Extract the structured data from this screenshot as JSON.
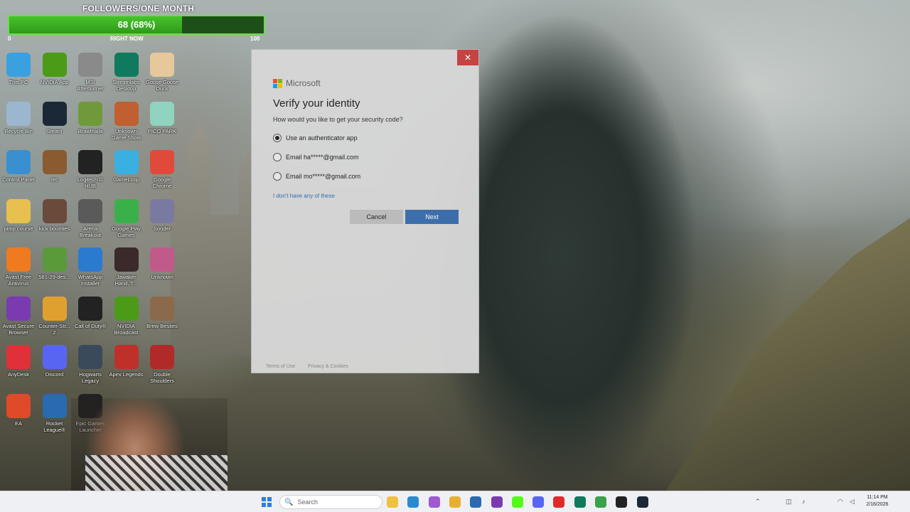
{
  "followers": {
    "title": "FOLLOWERS/ONE MONTH",
    "value_text": "68 (68%)",
    "progress": 68,
    "min_label": "0",
    "now_label": "RIGHT NOW",
    "max_label": "100"
  },
  "desktop_icons": [
    {
      "label": "This PC",
      "icon": "this-pc-icon",
      "color": "#3aa0e0"
    },
    {
      "label": "NVIDIA App",
      "icon": "nvidia-icon",
      "color": "#4b9b18"
    },
    {
      "label": "MSI Afterburner",
      "icon": "msi-icon",
      "color": "#8a8a8a"
    },
    {
      "label": "Streamlabs Desktop",
      "icon": "streamlabs-icon",
      "color": "#0f7a5d"
    },
    {
      "label": "Goose Goose Duck",
      "icon": "goose-icon",
      "color": "#e6c89a"
    },
    {
      "label": "Recycle Bin",
      "icon": "recycle-bin-icon",
      "color": "#9bb7d0"
    },
    {
      "label": "Steam",
      "icon": "steam-icon",
      "color": "#1b2838"
    },
    {
      "label": "Brawlhalla",
      "icon": "brawlhalla-icon",
      "color": "#6f9a3a"
    },
    {
      "label": "Unknown Game Show",
      "icon": "game-icon",
      "color": "#c06030"
    },
    {
      "label": "PICO PARK",
      "icon": "pico-park-icon",
      "color": "#8fd3c0"
    },
    {
      "label": "Control Panel",
      "icon": "control-panel-icon",
      "color": "#3a8fd0"
    },
    {
      "label": "rec",
      "icon": "rec-icon",
      "color": "#8a5a30"
    },
    {
      "label": "Logitech G HUB",
      "icon": "logitech-icon",
      "color": "#222222"
    },
    {
      "label": "GameLoop",
      "icon": "gameloop-icon",
      "color": "#3ab0e0"
    },
    {
      "label": "Google Chrome",
      "icon": "chrome-icon",
      "color": "#e04a3a"
    },
    {
      "label": "pimp course",
      "icon": "folder-icon",
      "color": "#e8c050"
    },
    {
      "label": "kick bounties",
      "icon": "kick-icon",
      "color": "#6a4a3a"
    },
    {
      "label": "Arena Breakout",
      "icon": "arena-icon",
      "color": "#5a5a5a"
    },
    {
      "label": "Google Play Games",
      "icon": "play-games-icon",
      "color": "#3ab04a"
    },
    {
      "label": "Sonder",
      "icon": "sonder-icon",
      "color": "#7a7aa0"
    },
    {
      "label": "Avast Free Antivirus",
      "icon": "avast-icon",
      "color": "#f07a20"
    },
    {
      "label": "581-29-des...",
      "icon": "file-icon",
      "color": "#5a9a3a"
    },
    {
      "label": "WhatsApp Installer",
      "icon": "download-icon",
      "color": "#2a7ad0"
    },
    {
      "label": "Jawaker Hand, T...",
      "icon": "jawaker-icon",
      "color": "#3a2a2a"
    },
    {
      "label": "Unknown",
      "icon": "unknown-icon",
      "color": "#c05a8a"
    },
    {
      "label": "Avast Secure Browser",
      "icon": "avast-browser-icon",
      "color": "#7a3ab0"
    },
    {
      "label": "Counter-Str... 2",
      "icon": "cs2-icon",
      "color": "#e0a030"
    },
    {
      "label": "Call of Duty®",
      "icon": "cod-icon",
      "color": "#222222"
    },
    {
      "label": "NVIDIA Broadcast",
      "icon": "nvidia-broadcast-icon",
      "color": "#4b9b18"
    },
    {
      "label": "Brew Besties",
      "icon": "brew-icon",
      "color": "#8a6a4a"
    },
    {
      "label": "AnyDesk",
      "icon": "anydesk-icon",
      "color": "#e0303a"
    },
    {
      "label": "Discord",
      "icon": "discord-icon",
      "color": "#5865f2"
    },
    {
      "label": "Hogwarts Legacy",
      "icon": "hogwarts-icon",
      "color": "#3a4a5a"
    },
    {
      "label": "Apex Legends",
      "icon": "apex-icon",
      "color": "#c0302a"
    },
    {
      "label": "Double Shoulders",
      "icon": "ds-icon",
      "color": "#b02a2a"
    },
    {
      "label": "EA",
      "icon": "ea-icon",
      "color": "#e04a2a"
    },
    {
      "label": "Rocket League®",
      "icon": "rocket-league-icon",
      "color": "#2a6ab0"
    },
    {
      "label": "Epic Games Launcher",
      "icon": "epic-icon",
      "color": "#222222"
    }
  ],
  "dialog": {
    "close_glyph": "✕",
    "brand": "Microsoft",
    "title": "Verify your identity",
    "prompt": "How would you like to get your security code?",
    "options": [
      {
        "label": "Use an authenticator app",
        "checked": true
      },
      {
        "label": "Email ha*****@gmail.com",
        "checked": false
      },
      {
        "label": "Email mo*****@gmail.com",
        "checked": false
      }
    ],
    "no_options_link": "I don't have any of these",
    "cancel_label": "Cancel",
    "next_label": "Next",
    "terms_label": "Terms of Use",
    "privacy_label": "Privacy & Cookies",
    "logo_colors": [
      "#f25022",
      "#7fba00",
      "#00a4ef",
      "#ffb900"
    ]
  },
  "taskbar": {
    "search_placeholder": "Search",
    "search_icon": "🔍",
    "time": "11:14 PM",
    "date": "2/16/2026",
    "apps": [
      {
        "name": "file-explorer-icon",
        "color": "#f0c040"
      },
      {
        "name": "edge-icon",
        "color": "#2a8ad0"
      },
      {
        "name": "copilot-icon",
        "color": "#a05ad0"
      },
      {
        "name": "folder-icon",
        "color": "#e8b030"
      },
      {
        "name": "store-icon",
        "color": "#2a6ab0"
      },
      {
        "name": "obs-icon",
        "color": "#7a3ab0"
      },
      {
        "name": "kick-icon",
        "color": "#53fc18"
      },
      {
        "name": "discord-icon",
        "color": "#5865f2"
      },
      {
        "name": "youtube-icon",
        "color": "#e02a2a"
      },
      {
        "name": "streamlabs-icon",
        "color": "#0f7a5d"
      },
      {
        "name": "chrome-icon",
        "color": "#3aa04a"
      },
      {
        "name": "capcut-icon",
        "color": "#222222"
      },
      {
        "name": "steam-icon",
        "color": "#1b2838"
      }
    ]
  }
}
